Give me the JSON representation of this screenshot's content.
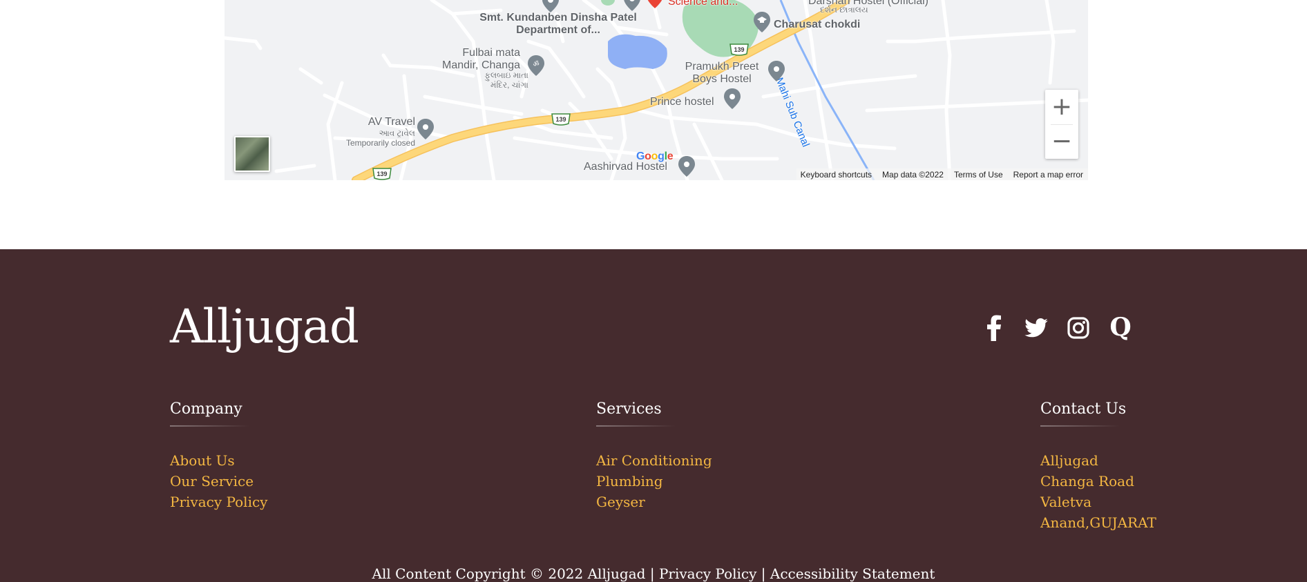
{
  "map": {
    "labels": {
      "science": "Science and...",
      "darshan": "Darshan Hostel (Official)",
      "darshan_gu": "દર્શન છાત્રાલય",
      "kundanben": "Smt. Kundanben Dinsha Patel Department of...",
      "charusat": "Charusat chokdi",
      "canal": "Mahi Sub Canal",
      "fulbai": "Fulbai mata Mandir, Changa",
      "fulbai_gu": "ફુલબાઇ માતા મંદિર, ચાંગા",
      "pramukh": "Pramukh Preet Boys Hostel",
      "prince": "Prince hostel",
      "av_travel": "AV Travel",
      "av_travel_gu": "આવ ટ્રાવેલ",
      "temporarily_closed": "Temporarily closed",
      "aashirvad": "Aashirvad Hostel",
      "route": "139"
    },
    "google_logo": "Google",
    "attribution": {
      "keyboard": "Keyboard shortcuts",
      "map_data": "Map data ©2022",
      "terms": "Terms of Use",
      "report": "Report a map error"
    },
    "zoom_in": "+",
    "zoom_out": "−"
  },
  "footer": {
    "brand": "Alljugad",
    "social_icons": [
      "facebook-icon",
      "twitter-icon",
      "instagram-icon",
      "quora-icon"
    ],
    "columns": {
      "company": {
        "title": "Company",
        "items": [
          "About Us",
          "Our Service",
          "Privacy Policy"
        ]
      },
      "services": {
        "title": "Services",
        "items": [
          "Air Conditioning",
          "Plumbing",
          "Geyser"
        ]
      },
      "contact": {
        "title": "Contact Us",
        "items": [
          "Alljugad",
          "Changa Road",
          "Valetva",
          "Anand,GUJARAT"
        ]
      }
    },
    "copyright": {
      "text": "All Content Copyright © 2022 Alljugad",
      "sep": "|",
      "privacy": "Privacy Policy",
      "accessibility": "Accessibility Statement"
    }
  },
  "colors": {
    "footer_bg": "#452b2e",
    "link": "#f4b742",
    "map_bg": "#f1f2f4",
    "highway": "#fdd77a"
  }
}
